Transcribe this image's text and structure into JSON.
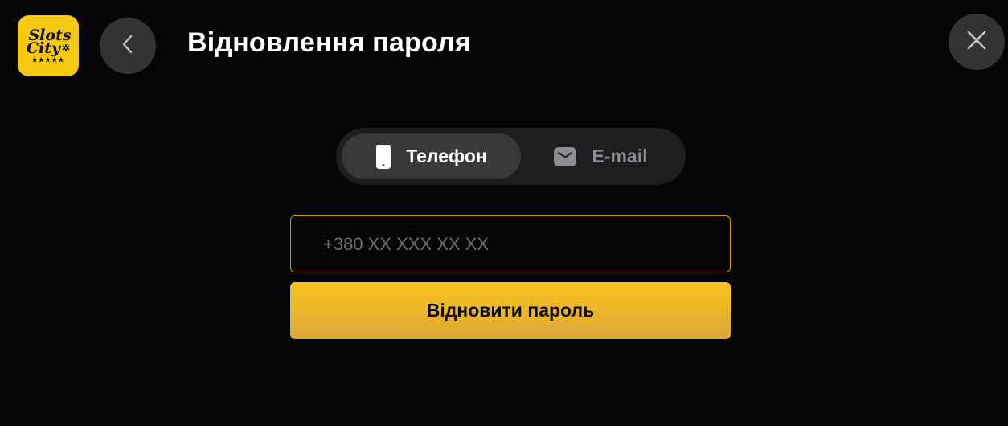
{
  "logo": {
    "line1": "Slots",
    "line2": "City",
    "stars": "★★★★★"
  },
  "header": {
    "title": "Відновлення пароля",
    "back_icon": "chevron-left-icon",
    "close_icon": "close-icon"
  },
  "tabs": [
    {
      "label": "Телефон",
      "icon": "phone-icon",
      "active": true
    },
    {
      "label": "E-mail",
      "icon": "mail-icon",
      "active": false
    }
  ],
  "form": {
    "phone_placeholder": "+380 XX XXX XX XX",
    "phone_value": "",
    "submit_label": "Відновити пароль"
  },
  "colors": {
    "background": "#060608",
    "accent": "#f6c21e",
    "input_border": "#c99a1a",
    "surface": "#333336"
  }
}
